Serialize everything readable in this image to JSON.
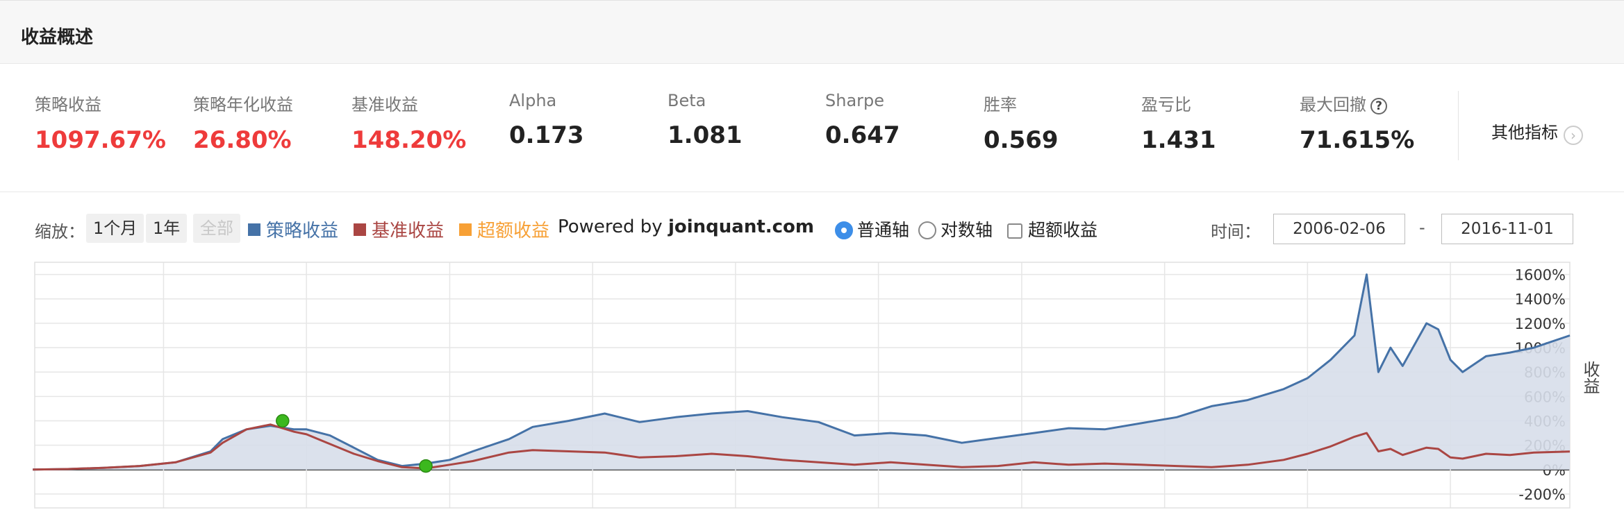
{
  "panel": {
    "title": "收益概述"
  },
  "metrics": [
    {
      "label": "策略收益",
      "value": "1097.67%",
      "color": "red"
    },
    {
      "label": "策略年化收益",
      "value": "26.80%",
      "color": "red"
    },
    {
      "label": "基准收益",
      "value": "148.20%",
      "color": "red"
    },
    {
      "label": "Alpha",
      "value": "0.173",
      "color": "normal"
    },
    {
      "label": "Beta",
      "value": "1.081",
      "color": "normal"
    },
    {
      "label": "Sharpe",
      "value": "0.647",
      "color": "normal"
    },
    {
      "label": "胜率",
      "value": "0.569",
      "color": "normal"
    },
    {
      "label": "盈亏比",
      "value": "1.431",
      "color": "normal"
    },
    {
      "label": "最大回撤",
      "value": "71.615%",
      "color": "normal",
      "help_icon": "?"
    }
  ],
  "other_metrics": {
    "label": "其他指标",
    "icon": "chevron-right-icon"
  },
  "toolbar": {
    "zoom_label": "缩放：",
    "zoom_buttons": [
      "1个月",
      "1年",
      "全部"
    ],
    "legend": [
      {
        "label": "策略收益",
        "color": "#4572a7"
      },
      {
        "label": "基准收益",
        "color": "#aa4643"
      },
      {
        "label": "超额收益",
        "color": "#f7a035"
      }
    ],
    "powered_prefix": "Powered by ",
    "powered_site": "joinquant.com",
    "axis_options": [
      "普通轴",
      "对数轴"
    ],
    "axis_selected": "普通轴",
    "excess_checkbox": "超额收益",
    "time_label": "时间：",
    "date_from": "2006-02-06",
    "date_dash": "-",
    "date_to": "2016-11-01"
  },
  "chart_data": {
    "type": "area",
    "ylabel": "收益",
    "y_ticks": [
      "1600%",
      "1400%",
      "1200%",
      "1000%",
      "800%",
      "600%",
      "400%",
      "200%",
      "0%",
      "-200%"
    ],
    "ylim": [
      -200,
      1700
    ],
    "xlim": [
      "2006-02-06",
      "2016-11-01"
    ],
    "grid": true,
    "series": [
      {
        "name": "策略收益",
        "color": "#4572a7",
        "fill": "#d7deea",
        "x": [
          "2006-02",
          "2006-05",
          "2006-08",
          "2006-11",
          "2007-02",
          "2007-05",
          "2007-06",
          "2007-08",
          "2007-10",
          "2007-12",
          "2008-01",
          "2008-03",
          "2008-05",
          "2008-07",
          "2008-09",
          "2008-11",
          "2009-01",
          "2009-03",
          "2009-06",
          "2009-08",
          "2009-11",
          "2010-02",
          "2010-05",
          "2010-08",
          "2010-11",
          "2011-02",
          "2011-05",
          "2011-08",
          "2011-11",
          "2012-02",
          "2012-05",
          "2012-08",
          "2012-11",
          "2013-02",
          "2013-05",
          "2013-08",
          "2013-11",
          "2014-02",
          "2014-05",
          "2014-08",
          "2014-11",
          "2015-01",
          "2015-03",
          "2015-05",
          "2015-06",
          "2015-07",
          "2015-08",
          "2015-09",
          "2015-11",
          "2015-12",
          "2016-01",
          "2016-02",
          "2016-04",
          "2016-06",
          "2016-08",
          "2016-11"
        ],
        "values": [
          0,
          5,
          15,
          30,
          60,
          150,
          250,
          330,
          360,
          330,
          330,
          280,
          180,
          80,
          30,
          50,
          80,
          150,
          250,
          350,
          400,
          460,
          390,
          430,
          460,
          480,
          430,
          390,
          280,
          300,
          280,
          220,
          260,
          300,
          340,
          330,
          380,
          430,
          520,
          570,
          660,
          750,
          900,
          1100,
          1600,
          800,
          1000,
          850,
          1200,
          1150,
          900,
          800,
          930,
          960,
          1000,
          1100
        ]
      },
      {
        "name": "基准收益",
        "color": "#aa4643",
        "x": [
          "2006-02",
          "2006-05",
          "2006-08",
          "2006-11",
          "2007-02",
          "2007-05",
          "2007-06",
          "2007-08",
          "2007-10",
          "2007-12",
          "2008-01",
          "2008-03",
          "2008-05",
          "2008-07",
          "2008-09",
          "2008-11",
          "2009-01",
          "2009-03",
          "2009-06",
          "2009-08",
          "2009-11",
          "2010-02",
          "2010-05",
          "2010-08",
          "2010-11",
          "2011-02",
          "2011-05",
          "2011-08",
          "2011-11",
          "2012-02",
          "2012-05",
          "2012-08",
          "2012-11",
          "2013-02",
          "2013-05",
          "2013-08",
          "2013-11",
          "2014-02",
          "2014-05",
          "2014-08",
          "2014-11",
          "2015-01",
          "2015-03",
          "2015-05",
          "2015-06",
          "2015-07",
          "2015-08",
          "2015-09",
          "2015-11",
          "2015-12",
          "2016-01",
          "2016-02",
          "2016-04",
          "2016-06",
          "2016-08",
          "2016-11"
        ],
        "values": [
          0,
          5,
          15,
          30,
          60,
          140,
          220,
          330,
          370,
          310,
          290,
          210,
          130,
          70,
          20,
          10,
          40,
          70,
          140,
          160,
          150,
          140,
          100,
          110,
          130,
          110,
          80,
          60,
          40,
          60,
          40,
          20,
          30,
          60,
          40,
          50,
          40,
          30,
          20,
          40,
          80,
          130,
          190,
          270,
          300,
          150,
          170,
          120,
          180,
          170,
          100,
          90,
          130,
          120,
          140,
          148
        ]
      }
    ],
    "markers": [
      {
        "date": "2007-11",
        "value": 400,
        "color": "#3cb81e"
      },
      {
        "date": "2008-11",
        "value": 30,
        "color": "#3cb81e"
      }
    ]
  }
}
